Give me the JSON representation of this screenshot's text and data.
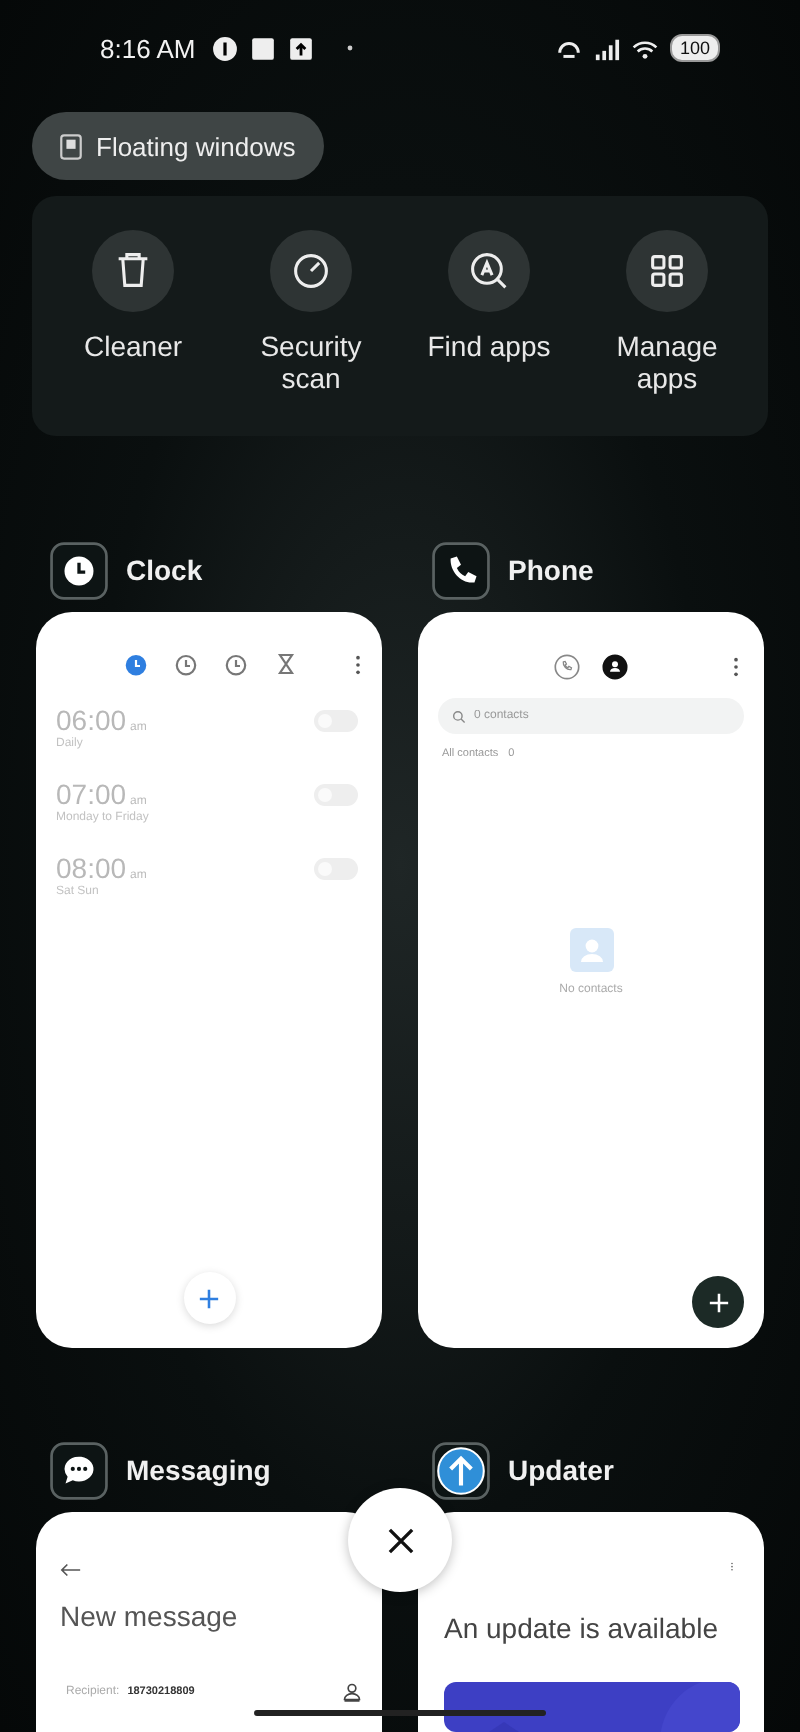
{
  "status_bar": {
    "time": "8:16 AM",
    "battery": "100"
  },
  "floating_windows": {
    "label": "Floating windows"
  },
  "tools": [
    {
      "kind": "trash",
      "label": "Cleaner"
    },
    {
      "kind": "gauge",
      "label": "Security scan"
    },
    {
      "kind": "find",
      "label": "Find apps"
    },
    {
      "kind": "grid",
      "label": "Manage apps"
    }
  ],
  "apps": [
    {
      "kind": "clock",
      "name": "Clock",
      "tabs": [
        {
          "kind": "alarm",
          "selected": true
        },
        {
          "kind": "clock",
          "selected": false
        },
        {
          "kind": "stopwatch",
          "selected": false
        },
        {
          "kind": "timer",
          "selected": false
        }
      ],
      "alarms": [
        {
          "time": "06:00",
          "period": "am",
          "repeat": "Daily",
          "on": false
        },
        {
          "time": "07:00",
          "period": "am",
          "repeat": "Monday to Friday",
          "on": false
        },
        {
          "time": "08:00",
          "period": "am",
          "repeat": "Sat Sun",
          "on": false
        }
      ]
    },
    {
      "kind": "phone",
      "name": "Phone",
      "tabs": [
        {
          "kind": "calls",
          "selected": false
        },
        {
          "kind": "contacts",
          "selected": true
        }
      ],
      "search": {
        "placeholder": "0 contacts"
      },
      "filter": "All contacts",
      "filter_count": "0",
      "empty": "No contacts"
    },
    {
      "kind": "messaging",
      "name": "Messaging",
      "title": "New message",
      "recipient_label": "Recipient:",
      "recipient": "18730218809"
    },
    {
      "kind": "updater",
      "name": "Updater",
      "title": "An update is available"
    }
  ]
}
